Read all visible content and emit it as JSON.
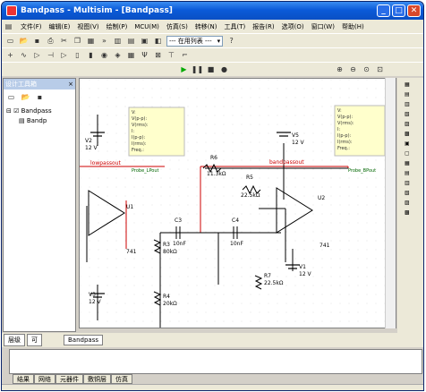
{
  "window": {
    "title": "Bandpass - Multisim - [Bandpass]",
    "btn_min": "_",
    "btn_max": "□",
    "btn_close": "✕"
  },
  "menu": [
    "文件(F)",
    "编辑(E)",
    "视图(V)",
    "绘制(P)",
    "MCU(M)",
    "仿真(S)",
    "转移(N)",
    "工具(T)",
    "报告(R)",
    "选项(O)",
    "窗口(W)",
    "帮助(H)"
  ],
  "toolbar": {
    "inuse_combo": "--- 在用列表 ---"
  },
  "left_panel": {
    "title": "设计工具箱",
    "close": "×",
    "root": "Bandpass",
    "child": "Bandp"
  },
  "tabs": {
    "level": "层级",
    "visibility": "可",
    "design": "Bandpass"
  },
  "bottom_tabs": [
    "结果",
    "网络",
    "元器件",
    "敷铜层",
    "仿真"
  ],
  "schematic": {
    "V2": "V2",
    "V2v": "12 V",
    "V3": "V3",
    "V3v": "12 V",
    "V5": "V5",
    "V5v": "12 V",
    "V1": "V1",
    "V1v": "12 V",
    "U1": "U1",
    "U2": "U2",
    "op1": "741",
    "op2": "741",
    "R3": "R3",
    "R3v": "80kΩ",
    "R4": "R4",
    "R4v": "20kΩ",
    "R6": "R6",
    "R6v": "11.3kΩ",
    "R5": "R5",
    "R5v": "22.5kΩ",
    "R7": "R7",
    "R7v": "22.5kΩ",
    "C3": "C3",
    "C3v": "10nF",
    "C4": "C4",
    "C4v": "10nF",
    "net1": "lowpassout",
    "net2": "bandpassout",
    "probe1": "Probe_LPout",
    "probe2": "Probe_BPout",
    "probe_text": [
      "V:",
      "V(p-p):",
      "V(rms):",
      "I:",
      "I(p-p):",
      "I(rms):",
      "Freq.:"
    ]
  }
}
